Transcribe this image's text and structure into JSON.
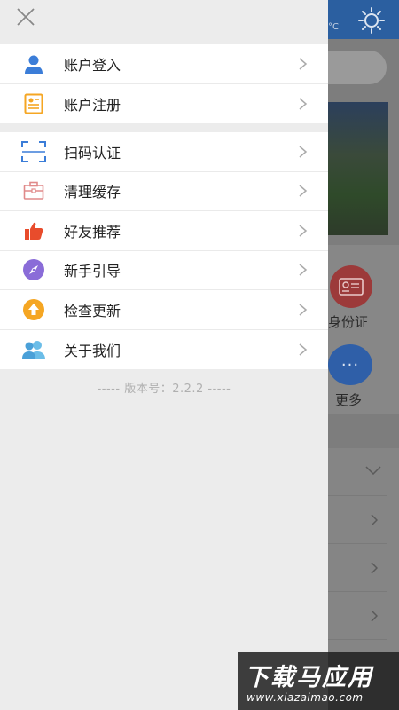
{
  "drawer": {
    "groups": [
      {
        "items": [
          {
            "label": "账户登入",
            "icon": "user-icon"
          },
          {
            "label": "账户注册",
            "icon": "register-icon"
          }
        ]
      },
      {
        "items": [
          {
            "label": "扫码认证",
            "icon": "scan-icon"
          },
          {
            "label": "清理缓存",
            "icon": "briefcase-icon"
          },
          {
            "label": "好友推荐",
            "icon": "thumbs-up-icon"
          },
          {
            "label": "新手引导",
            "icon": "compass-icon"
          },
          {
            "label": "检查更新",
            "icon": "upload-icon"
          },
          {
            "label": "关于我们",
            "icon": "people-icon"
          }
        ]
      }
    ],
    "version": "----- 版本号：2.2.2 -----"
  },
  "background": {
    "temp_suffix": "°C",
    "id_label": "身份证",
    "more_label": "更多",
    "more_glyph": "···"
  },
  "watermark": {
    "title": "下载马应用",
    "url": "www.xiazaimao.com"
  },
  "colors": {
    "accent_blue": "#3b7dd8",
    "orange": "#f5a623",
    "red": "#e84c2c",
    "purple": "#8a6cd8",
    "pink": "#e08a8a"
  }
}
